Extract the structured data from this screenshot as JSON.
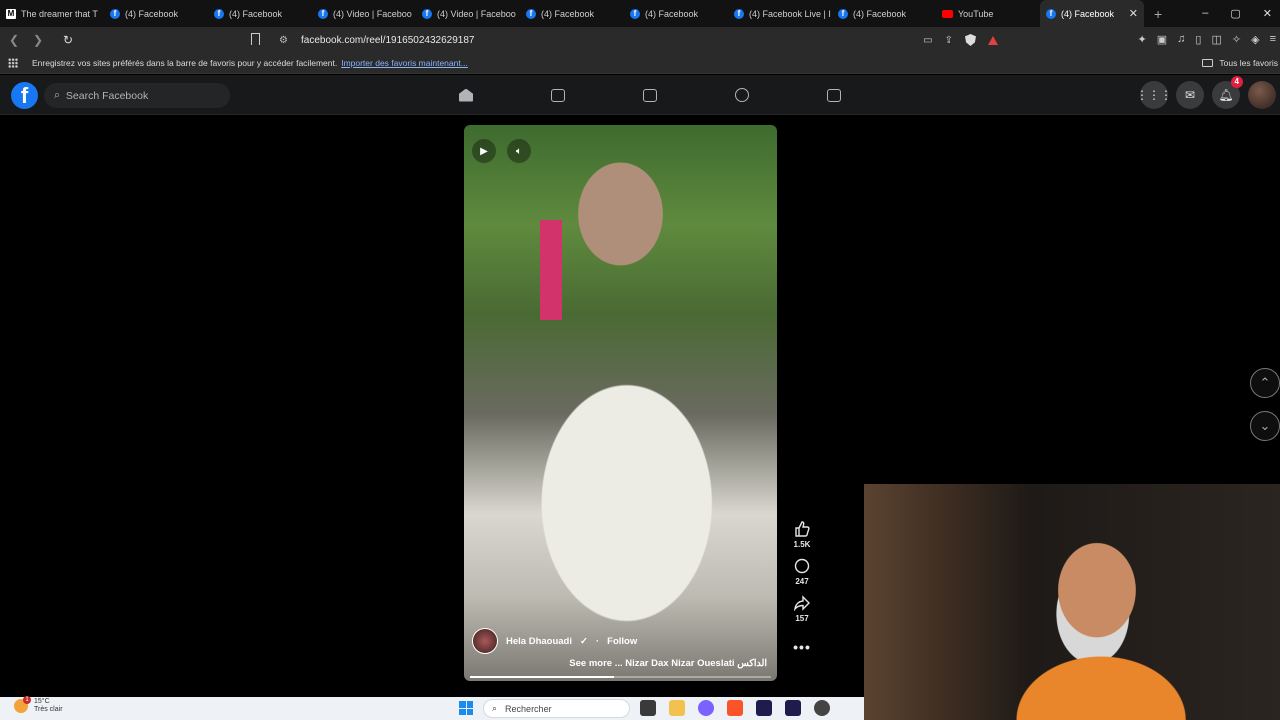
{
  "browser": {
    "tabs": [
      {
        "title": "The dreamer that T",
        "icon": "m",
        "active": false
      },
      {
        "title": "(4) Facebook",
        "icon": "f",
        "active": false
      },
      {
        "title": "(4) Facebook",
        "icon": "f",
        "active": false
      },
      {
        "title": "(4) Video | Faceboo",
        "icon": "f",
        "active": false
      },
      {
        "title": "(4) Video | Faceboo",
        "icon": "f",
        "active": false
      },
      {
        "title": "(4) Facebook",
        "icon": "f",
        "active": false
      },
      {
        "title": "(4) Facebook",
        "icon": "f",
        "active": false
      },
      {
        "title": "(4) Facebook Live | I",
        "icon": "f",
        "active": false
      },
      {
        "title": "(4) Facebook",
        "icon": "f",
        "active": false
      },
      {
        "title": "YouTube",
        "icon": "yt",
        "active": false
      },
      {
        "title": "(4) Facebook",
        "icon": "f",
        "active": true
      }
    ],
    "new_tab": "+",
    "window_controls": {
      "minimize": "–",
      "maximize": "▢",
      "close": "✕"
    },
    "url": "facebook.com/reel/1916502432629187",
    "bookmarks_bar": {
      "message": "Enregistrez vos sites préférés dans la barre de favoris pour y accéder facilement.",
      "import_link": "Importer des favoris maintenant...",
      "all_favorites": "Tous les favoris"
    }
  },
  "facebook": {
    "logo": "f",
    "search_placeholder": "Search Facebook",
    "nav": [
      "home-icon",
      "video-icon",
      "marketplace-icon",
      "groups-icon",
      "gaming-icon"
    ],
    "notifications_badge": "4"
  },
  "reel": {
    "author": "Hela Dhaouadi",
    "follow": "Follow",
    "caption": "See more ... Nizar Dax Nizar Oueslati الداكس",
    "likes": "1.5K",
    "comments": "247",
    "shares": "157",
    "progress": 0.48
  },
  "taskbar": {
    "weather_temp": "15°C",
    "weather_desc": "Très clair",
    "weather_badge": "1",
    "search_placeholder": "Rechercher"
  },
  "colors": {
    "facebook_blue": "#1877f2",
    "fb_dark": "#18191a",
    "badge_red": "#e41e3f"
  }
}
